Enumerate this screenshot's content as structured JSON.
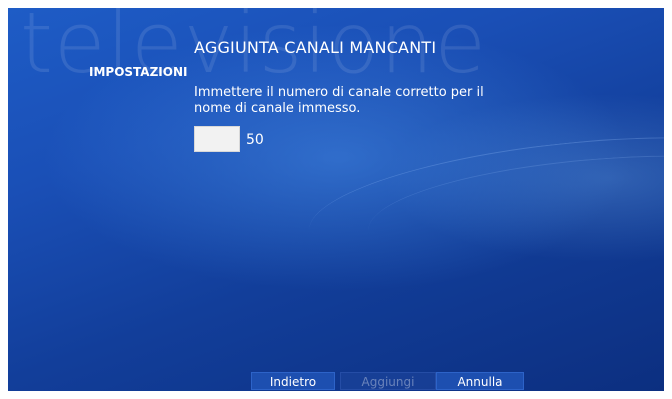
{
  "window": {
    "watermark": "televisione",
    "section": "IMPOSTAZIONI",
    "title": "AGGIUNTA CANALI MANCANTI"
  },
  "form": {
    "instructions": "Immettere il numero di canale corretto per il nome di canale immesso.",
    "channel_number_value": "",
    "channel_name": "50"
  },
  "buttons": {
    "back": "Indietro",
    "add": "Aggiungi",
    "cancel": "Annulla"
  }
}
